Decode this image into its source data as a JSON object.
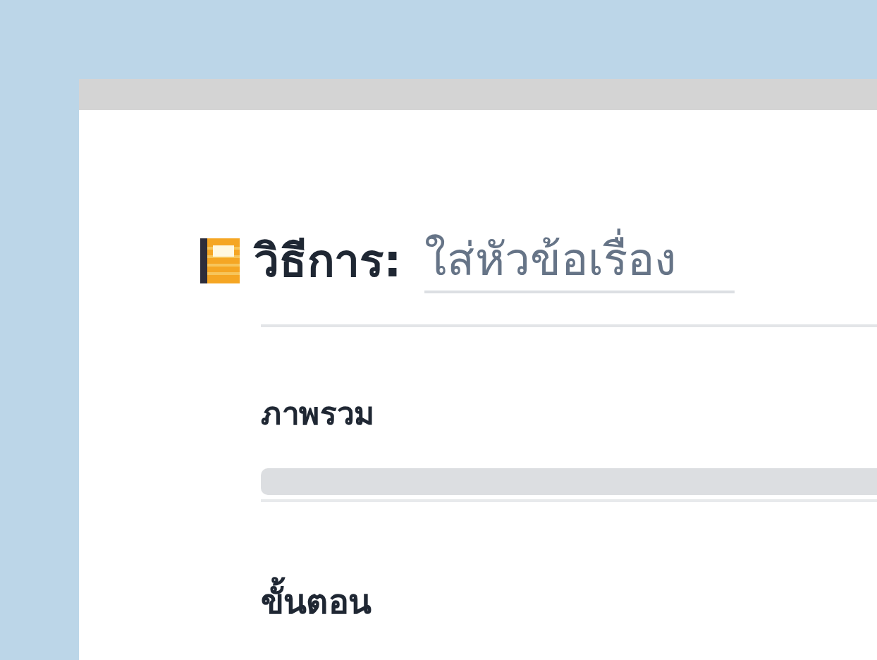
{
  "title": {
    "label": "วิธีการ:",
    "field": {
      "placeholder": "ใส่หัวข้อเรื่อง"
    }
  },
  "sections": [
    {
      "heading": "ภาพรวม",
      "kind": "field"
    },
    {
      "heading": "ขั้นตอน",
      "kind": "heading"
    }
  ]
}
